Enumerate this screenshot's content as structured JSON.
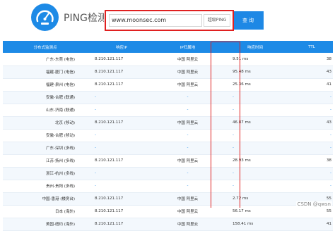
{
  "header": {
    "title": "PING检测",
    "logo_icon": "speedometer-icon"
  },
  "search": {
    "value": "www.moonsec.com",
    "select_label": "超级PING",
    "button_label": "查询"
  },
  "table": {
    "columns": [
      "分布式监测点",
      "响应IP",
      "IP归属地",
      "响应时间",
      "TTL"
    ],
    "rows": [
      [
        "广东-东莞 (电信)",
        "8.210.121.117",
        "中国 阿里云",
        "9.51 ms",
        "38"
      ],
      [
        "福建-厦门 (电信)",
        "8.210.121.117",
        "中国 阿里云",
        "95.48 ms",
        "43"
      ],
      [
        "福建-泉州 (电信)",
        "8.210.121.117",
        "中国 阿里云",
        "25.36 ms",
        "41"
      ],
      [
        "安徽-合肥 (联通)",
        "-",
        "-",
        "-",
        "-"
      ],
      [
        "山东-济南 (联通)",
        "-",
        "-",
        "-",
        "-"
      ],
      [
        "北京 (移动)",
        "8.210.121.117",
        "中国 阿里云",
        "46.87 ms",
        "43"
      ],
      [
        "安徽-合肥 (移动)",
        "-",
        "-",
        "-",
        "-"
      ],
      [
        "广东-深圳 (多线)",
        "-",
        "-",
        "-",
        "-"
      ],
      [
        "江苏-扬州 (多线)",
        "8.210.121.117",
        "中国 阿里云",
        "28.93 ms",
        "38"
      ],
      [
        "浙江-杭州 (多线)",
        "-",
        "-",
        "-",
        "-"
      ],
      [
        "贵州-贵阳 (多线)",
        "-",
        "-",
        "-",
        "-"
      ],
      [
        "中国-香港 (楼房台)",
        "8.210.121.117",
        "中国 阿里云",
        "2.72 ms",
        "55"
      ],
      [
        "日本 (海外)",
        "8.210.121.117",
        "中国 阿里云",
        "56.17 ms",
        "55"
      ],
      [
        "美国-纽约 (海外)",
        "8.210.121.117",
        "中国 阿里云",
        "158.41 ms",
        "41"
      ]
    ]
  },
  "watermark": "CSDN @qwsn",
  "colors": {
    "accent": "#1d8ae6",
    "highlight": "#e02020"
  }
}
